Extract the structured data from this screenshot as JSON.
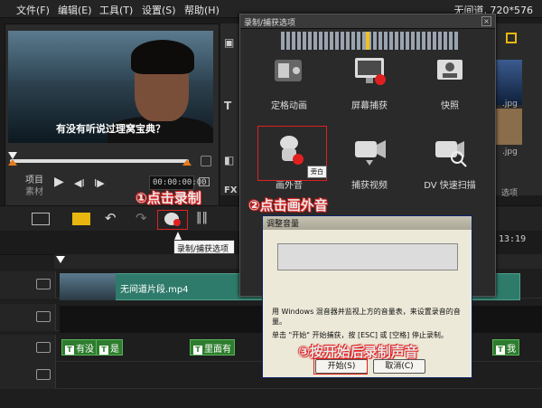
{
  "menu": {
    "file": "文件(F)",
    "edit": "编辑(E)",
    "tools": "工具(T)",
    "settings": "设置(S)",
    "help": "帮助(H)"
  },
  "window": {
    "title_info": "无间道, 720*576"
  },
  "preview": {
    "subtitle": "有没有听说过理窝宝典？",
    "mode_project": "项目",
    "mode_clip": "素材",
    "timecode": "00:00:00:00"
  },
  "library": {
    "thumb_label_1": ".jpg",
    "thumb_label_2": ".jpg",
    "options": "选项"
  },
  "capture_dialog": {
    "title": "录制/捕获选项",
    "close": "×",
    "options": [
      {
        "label": "定格动画",
        "icon": "stop-motion-icon"
      },
      {
        "label": "屏幕捕获",
        "icon": "screen-capture-icon"
      },
      {
        "label": "快照",
        "icon": "snapshot-icon"
      },
      {
        "label": "画外音",
        "icon": "voiceover-icon"
      },
      {
        "label": "捕获视频",
        "icon": "capture-video-icon"
      },
      {
        "label": "DV 快速扫描",
        "icon": "dv-scan-icon"
      }
    ],
    "voiceover_tooltip": "旁白"
  },
  "timeline_toolbar": {
    "record_tooltip": "录制/捕获选项",
    "duration": "13:19"
  },
  "annotations": {
    "step1": "①点击录制",
    "step2": "②点击画外音",
    "step3": "③按开始后录制声音"
  },
  "timeline": {
    "video_clip_name": "无间道片段.mp4",
    "title_clips": [
      "有没",
      "是",
      "里面有",
      "我"
    ]
  },
  "sound_dialog": {
    "title": "调整音量",
    "text_line1": "用 Windows 混音器并监视上方的音量表，来设置录音的音量。",
    "text_line2": "单击 \"开始\" 开始捕获，按 [ESC] 或 [空格] 停止录制。",
    "start": "开始(S)",
    "cancel": "取消(C)"
  },
  "colors": {
    "annotation_red": "#e02020",
    "timeline_clip_green": "#2e7d2e",
    "video_clip_teal": "#2f7b6b",
    "accent_yellow": "#e8b60f"
  }
}
